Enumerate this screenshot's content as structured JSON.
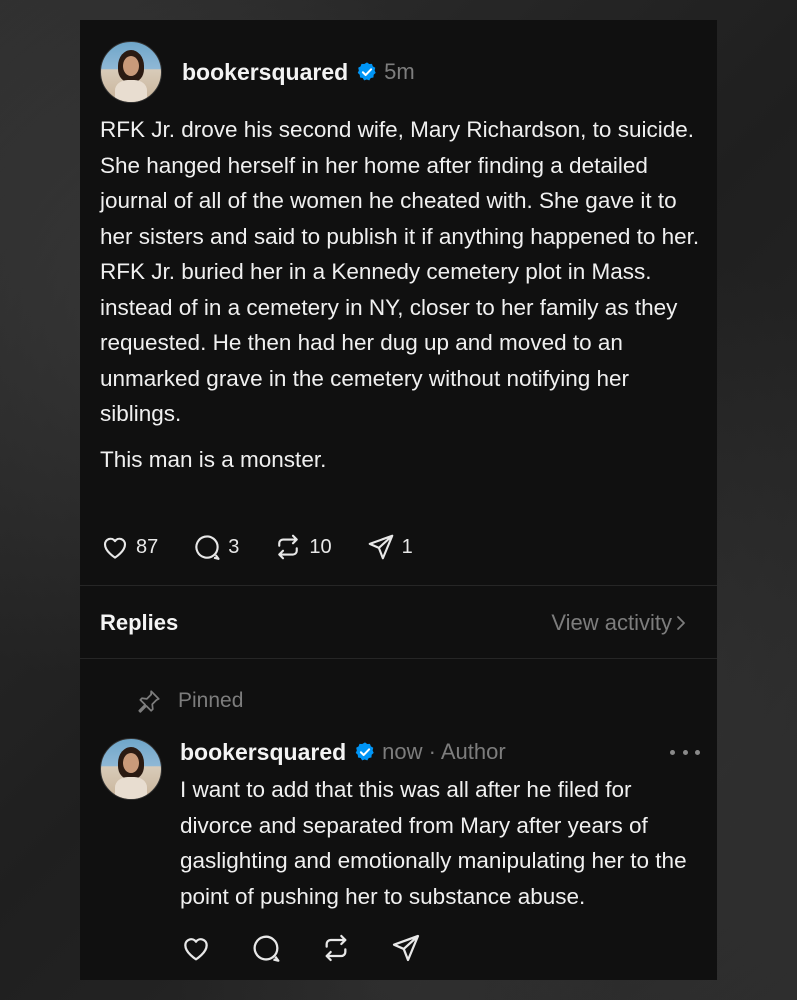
{
  "post": {
    "username": "bookersquared",
    "time": "5m",
    "paragraphs": [
      "RFK Jr. drove his second wife, Mary Richardson, to suicide. She hanged herself in her home after finding a detailed journal of all of the women he cheated with. She gave it to her sisters and said to publish it if anything happened to her. RFK Jr. buried her in a Kennedy cemetery plot in Mass. instead of in a cemetery in NY, closer to her family as they requested. He then had her dug up and moved to an unmarked grave in the cemetery without notifying her siblings.",
      "This man is a monster."
    ],
    "likes": "87",
    "comments": "3",
    "reposts": "10",
    "shares": "1"
  },
  "replies": {
    "title": "Replies",
    "view_activity": "View activity",
    "pinned_label": "Pinned",
    "reply": {
      "username": "bookersquared",
      "meta": "now · Author",
      "text": "I want to add that this was all after he filed for divorce and separated from Mary after years of gaslighting and emotionally manipulating her to the point of pushing her to substance abuse."
    }
  },
  "colors": {
    "card_bg": "#101010",
    "text": "#f0f0f0",
    "muted": "#7d7d7d",
    "verified": "#0095f6"
  },
  "icons": [
    "heart-icon",
    "comment-icon",
    "repost-icon",
    "share-icon",
    "pin-icon",
    "verified-badge-icon",
    "more-icon",
    "chevron-right-icon"
  ]
}
